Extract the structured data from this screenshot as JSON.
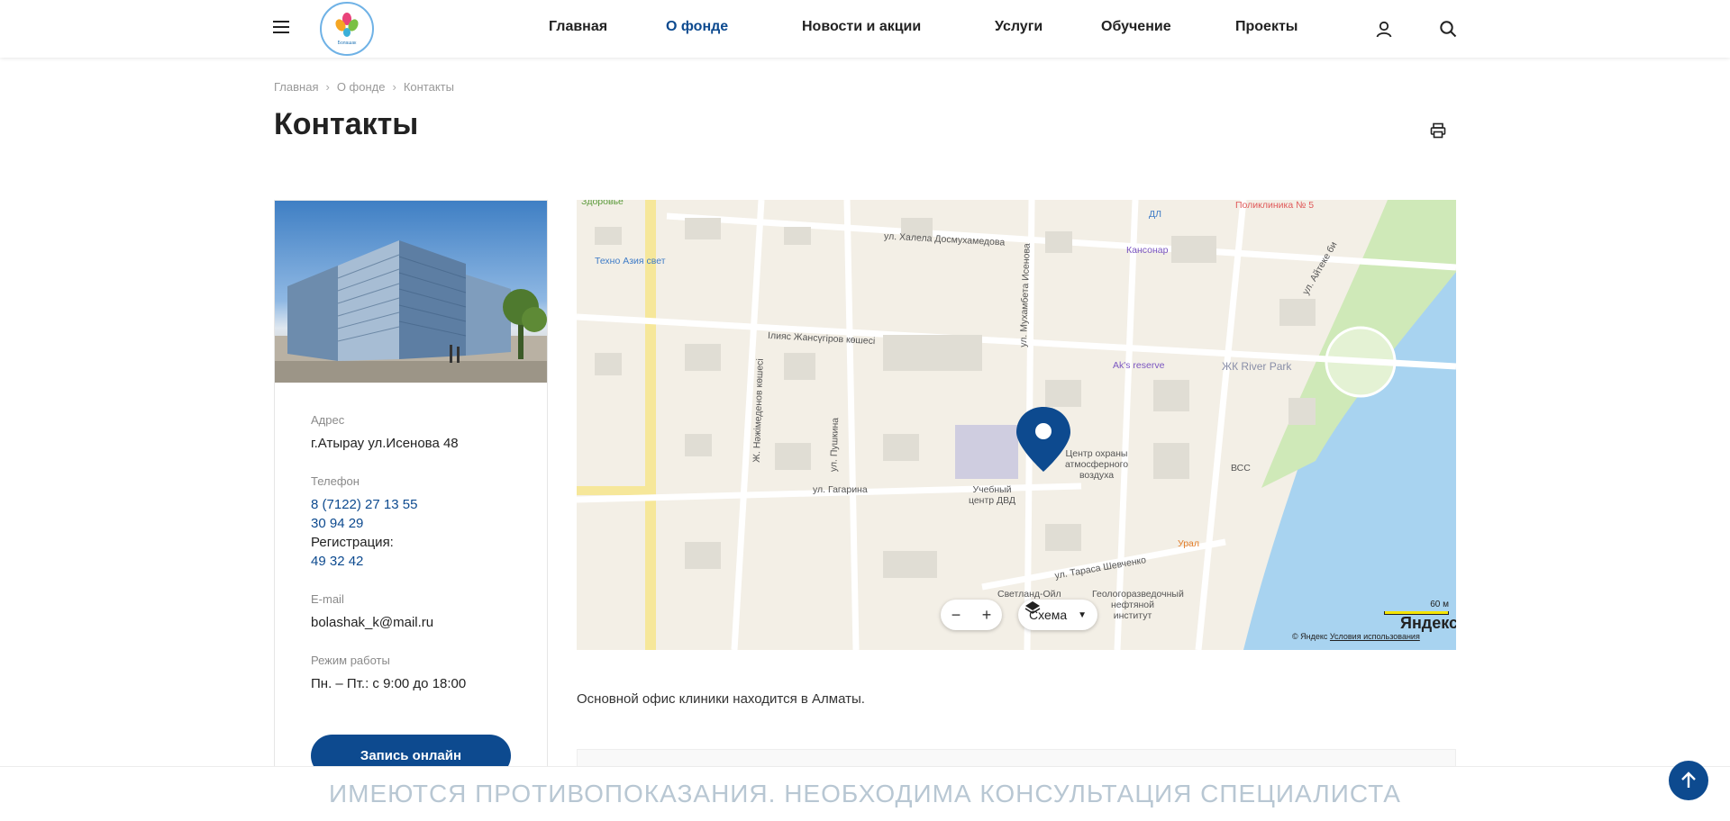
{
  "header": {
    "nav": [
      {
        "label": "Главная",
        "active": false
      },
      {
        "label": "О фонде",
        "active": true
      },
      {
        "label": "Новости и акции",
        "active": false
      },
      {
        "label": "Услуги",
        "active": false
      },
      {
        "label": "Обучение",
        "active": false
      },
      {
        "label": "Проекты",
        "active": false
      }
    ],
    "icons": [
      "menu-icon",
      "logo",
      "user-icon",
      "search-icon"
    ],
    "logo_text": "Болашак"
  },
  "breadcrumb": [
    "Главная",
    "О фонде",
    "Контакты"
  ],
  "page_title": "Контакты",
  "contact": {
    "address_label": "Адрес",
    "address": "г.Атырау ул.Исенова 48",
    "phone_label": "Телефон",
    "phone1": "8 (7122) 27 13 55",
    "phone2": "30 94 29",
    "registration_label": "Регистрация:",
    "registration_phone": "49 32 42",
    "email_label": "E-mail",
    "email": "bolashak_k@mail.ru",
    "hours_label": "Режим работы",
    "hours": "Пн. – Пт.: с 9:00 до 18:00",
    "button": "Запись онлайн"
  },
  "map": {
    "streets": [
      "ул. Халела Досмухамедова",
      "Ілияс Жансүгіров көшесі",
      "ул. Мухамбета Исенова",
      "ул. Гагарина",
      "ул. Пушкина",
      "Ж. Нәжімеденов көшесі",
      "ул. Тараса Шевченко",
      "ул. Айтеке би"
    ],
    "places": [
      "Техно Азия свет",
      "ДЛ",
      "Кансонар",
      "Поликлиника № 5",
      "Ak's reserve",
      "ЖК River Park",
      "Центр охраны атмосферного воздуха",
      "Учебный центр ДВД",
      "ВСС",
      "Урал",
      "Светланд-Ойл",
      "Геологоразведочный нефтяной институт",
      "Здоровье"
    ],
    "zoom_out": "−",
    "zoom_in": "+",
    "scheme_label": "Схема",
    "scale": "60 м",
    "brand": "Яндекс",
    "copyright": "© Яндекс",
    "terms": "Условия использования"
  },
  "note": "Основной офис клиники находится в Алматы.",
  "warning": "ИМЕЮТСЯ ПРОТИВОПОКАЗАНИЯ. НЕОБХОДИМА КОНСУЛЬТАЦИЯ СПЕЦИАЛИСТА",
  "colors": {
    "brand": "#0d4a8f",
    "warning": "#b8c7d3"
  }
}
